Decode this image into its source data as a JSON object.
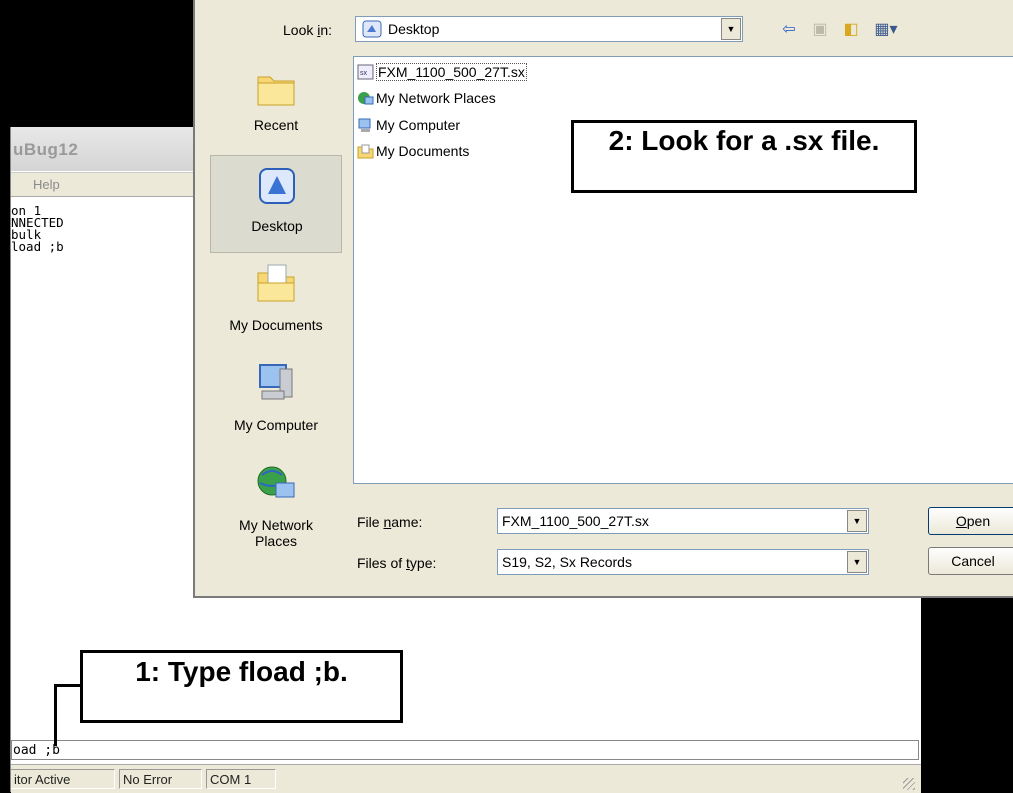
{
  "app": {
    "title": "uBug12",
    "menu_help": "Help",
    "console_lines": [
      "on 1",
      "NNECTED",
      "bulk",
      "load ;b"
    ],
    "command_value": "oad ;b",
    "status": [
      "itor Active",
      "No Error",
      "COM 1"
    ]
  },
  "dialog": {
    "look_in_label": "Look in:",
    "look_in_value": "Desktop",
    "places": [
      {
        "label": "Recent",
        "icon": "recent-folder-icon"
      },
      {
        "label": "Desktop",
        "icon": "desktop-icon"
      },
      {
        "label": "My Documents",
        "icon": "my-documents-icon"
      },
      {
        "label": "My Computer",
        "icon": "my-computer-icon"
      },
      {
        "label": "My Network Places",
        "icon": "network-places-icon"
      }
    ],
    "files": [
      {
        "name": "FXM_1100_500_27T.sx",
        "icon": "sx-file-icon"
      },
      {
        "name": "My Network Places",
        "icon": "network-places-icon"
      },
      {
        "name": "My Computer",
        "icon": "my-computer-icon"
      },
      {
        "name": "My Documents",
        "icon": "my-documents-icon"
      }
    ],
    "file_name_label": "File name:",
    "file_name_value": "FXM_1100_500_27T.sx",
    "files_of_type_label": "Files of type:",
    "files_of_type_value": "S19, S2, Sx Records",
    "open_label": "Open",
    "cancel_label": "Cancel"
  },
  "callouts": {
    "step1": "1: Type fload ;b.",
    "step2": "2: Look for a .sx file."
  },
  "colors": {
    "dialog_bg": "#ece9d8",
    "field_border": "#7f9db9",
    "selection": "#dcdbd0"
  }
}
